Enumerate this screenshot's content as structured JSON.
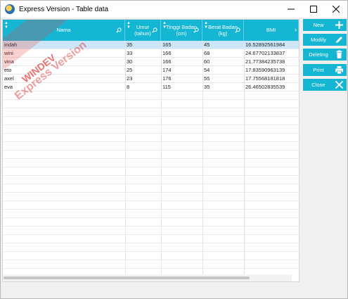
{
  "window": {
    "title": "Express Version - Table data",
    "minimize": "minimize",
    "maximize": "maximize",
    "close": "close"
  },
  "table": {
    "columns": [
      "Nama",
      "Umur\n(tahun)",
      "Tinggi Badan\n(cm)",
      "Berat Badan\n(kg)",
      "BMI"
    ],
    "rows": [
      [
        "indah",
        "35",
        "165",
        "45",
        "16.52892561984"
      ],
      [
        "wini",
        "33",
        "166",
        "68",
        "24.67702133837"
      ],
      [
        "vina",
        "30",
        "166",
        "60",
        "21.77384235738"
      ],
      [
        "eto",
        "25",
        "174",
        "54",
        "17.83590963139"
      ],
      [
        "axel",
        "23",
        "176",
        "55",
        "17.75568181818"
      ],
      [
        "eva",
        "8",
        "115",
        "35",
        "26.46502835539"
      ]
    ],
    "selected_row": 0,
    "empty_rows": 22
  },
  "watermark": {
    "line1": "WINDEV",
    "line2": "Express Version"
  },
  "buttons": {
    "new": "New",
    "modify": "Modify",
    "deleting": "Deleting",
    "print": "Print",
    "close": "Close"
  },
  "icons": {
    "new": "plus-icon",
    "modify": "pencil-icon",
    "deleting": "trash-icon",
    "print": "printer-icon",
    "close": "x-icon"
  },
  "colors": {
    "accent": "#14b6d3",
    "selection": "#cde6f7",
    "watermark": "#dc2828"
  }
}
